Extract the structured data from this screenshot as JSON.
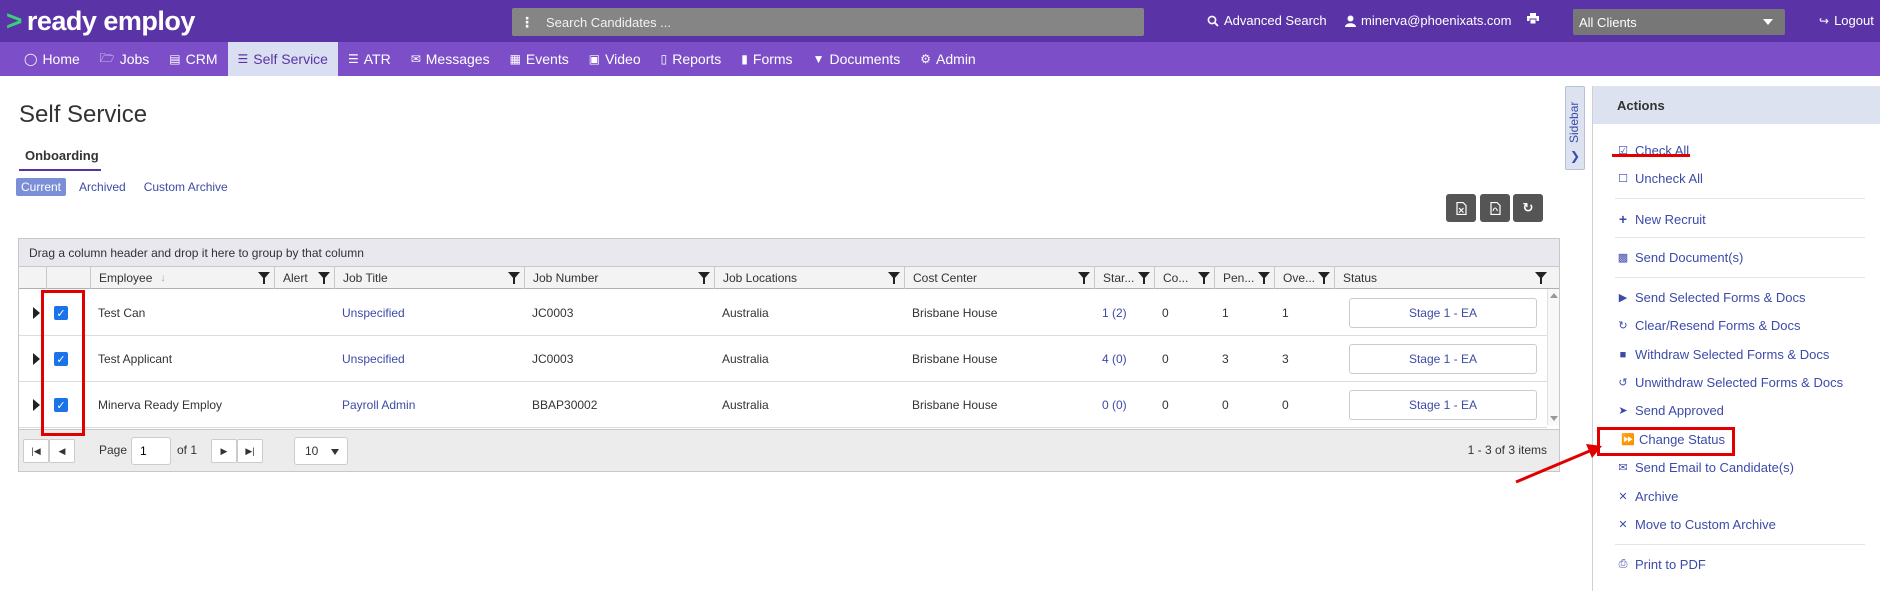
{
  "app": {
    "logo_text": "ready employ",
    "search_placeholder": "Search Candidates ...",
    "advanced_search": "Advanced Search",
    "user_email": "minerva@phoenixats.com",
    "client_selected": "All Clients",
    "logout": "Logout"
  },
  "nav": {
    "items": [
      {
        "label": "Home",
        "icon": "home-icon"
      },
      {
        "label": "Jobs",
        "icon": "folder-icon"
      },
      {
        "label": "CRM",
        "icon": "crm-icon"
      },
      {
        "label": "Self Service",
        "icon": "list-icon",
        "active": true
      },
      {
        "label": "ATR",
        "icon": "atr-icon"
      },
      {
        "label": "Messages",
        "icon": "envelope-icon"
      },
      {
        "label": "Events",
        "icon": "calendar-icon"
      },
      {
        "label": "Video",
        "icon": "video-icon"
      },
      {
        "label": "Reports",
        "icon": "report-icon"
      },
      {
        "label": "Forms",
        "icon": "forms-icon"
      },
      {
        "label": "Documents",
        "icon": "filter-icon"
      },
      {
        "label": "Admin",
        "icon": "gear-icon"
      }
    ]
  },
  "page": {
    "title": "Self Service",
    "tab": "Onboarding",
    "subtabs": [
      "Current",
      "Archived",
      "Custom Archive"
    ]
  },
  "grid": {
    "group_hint": "Drag a column header and drop it here to group by that column",
    "headers": [
      "Employee",
      "Alert",
      "Job Title",
      "Job Number",
      "Job Locations",
      "Cost Center",
      "Star...",
      "Co...",
      "Pen...",
      "Ove...",
      "Status"
    ],
    "rows": [
      {
        "employee": "Test Can",
        "alert": "",
        "job_title": "Unspecified",
        "job_number": "JC0003",
        "location": "Australia",
        "cost_center": "Brisbane House",
        "started": "1 (2)",
        "completed": "0",
        "pending": "1",
        "overdue": "1",
        "status": "Stage 1 - EA",
        "checked": true
      },
      {
        "employee": "Test Applicant",
        "alert": "",
        "job_title": "Unspecified",
        "job_number": "JC0003",
        "location": "Australia",
        "cost_center": "Brisbane House",
        "started": "4 (0)",
        "completed": "0",
        "pending": "3",
        "overdue": "3",
        "status": "Stage 1 - EA",
        "checked": true
      },
      {
        "employee": "Minerva Ready Employ",
        "alert": "",
        "job_title": "Payroll Admin",
        "job_number": "BBAP30002",
        "location": "Australia",
        "cost_center": "Brisbane House",
        "started": "0 (0)",
        "completed": "0",
        "pending": "0",
        "overdue": "0",
        "status": "Stage 1 - EA",
        "checked": true
      }
    ],
    "pager": {
      "page_label": "Page",
      "page_value": "1",
      "of_label": "of 1",
      "page_size": "10",
      "info": "1 - 3 of 3 items"
    }
  },
  "sidebar_toggle": "Sidebar",
  "actions": {
    "title": "Actions",
    "items": [
      {
        "label": "Check All",
        "icon": "check-square-icon"
      },
      {
        "label": "Uncheck All",
        "icon": "square-icon"
      },
      {
        "label": "New Recruit",
        "icon": "plus-icon"
      },
      {
        "label": "Send Document(s)",
        "icon": "send-doc-icon"
      },
      {
        "label": "Send Selected Forms & Docs",
        "icon": "play-icon"
      },
      {
        "label": "Clear/Resend Forms & Docs",
        "icon": "refresh-icon"
      },
      {
        "label": "Withdraw Selected Forms & Docs",
        "icon": "stop-icon"
      },
      {
        "label": "Unwithdraw Selected Forms & Docs",
        "icon": "undo-icon"
      },
      {
        "label": "Send Approved",
        "icon": "paper-plane-icon"
      },
      {
        "label": "Change Status",
        "icon": "fast-forward-icon"
      },
      {
        "label": "Send Email to Candidate(s)",
        "icon": "envelope-icon"
      },
      {
        "label": "Archive",
        "icon": "x-icon"
      },
      {
        "label": "Move to Custom Archive",
        "icon": "x-icon"
      },
      {
        "label": "Print to PDF",
        "icon": "printer-icon"
      }
    ]
  },
  "colors": {
    "topbar": "#5a34a6",
    "navbar": "#7c4fc8",
    "link": "#3c4ba8",
    "annotation": "#e00000"
  }
}
